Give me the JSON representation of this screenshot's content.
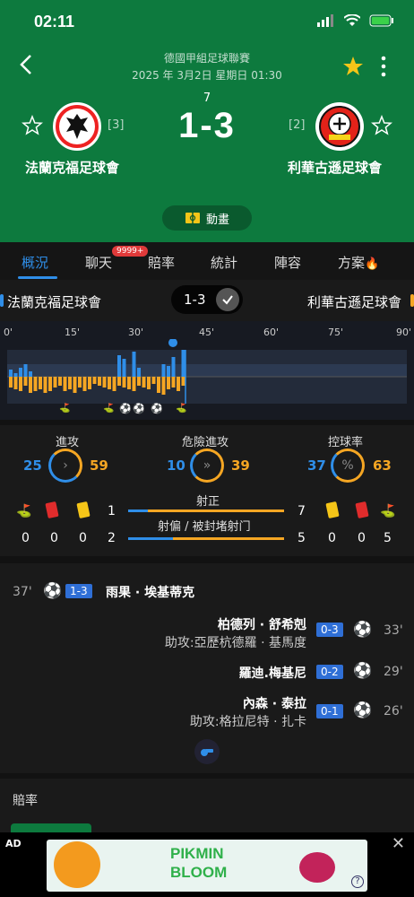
{
  "status_bar": {
    "time": "02:11"
  },
  "match": {
    "league": "德國甲組足球聯賽",
    "datetime": "2025 年 3月2日 星期日 01:30",
    "round": "7",
    "score": "1-3",
    "home": {
      "name": "法蘭克福足球會",
      "rank": "[3]"
    },
    "away": {
      "name": "利華古遜足球會",
      "rank": "[2]"
    },
    "animation_label": "動畫"
  },
  "tabs": [
    {
      "label": "概況"
    },
    {
      "label": "聊天"
    },
    {
      "label": "賠率"
    },
    {
      "label": "統計"
    },
    {
      "label": "陣容"
    },
    {
      "label": "方案"
    }
  ],
  "chat_badge": "9999+",
  "team_bar": {
    "home": "法蘭克福足球會",
    "score": "1-3",
    "away": "利華古遜足球會"
  },
  "timeline": {
    "minute_labels": [
      "0'",
      "15'",
      "30'",
      "45'",
      "60'",
      "75'",
      "90'"
    ],
    "current_minute": 45
  },
  "stats": {
    "attack": {
      "label": "進攻",
      "home": "25",
      "away": "59"
    },
    "dangerous_attack": {
      "label": "危險進攻",
      "home": "10",
      "away": "39"
    },
    "possession": {
      "label": "控球率",
      "home": "37",
      "away": "63"
    },
    "shots_on_target": {
      "label": "射正",
      "home": "1",
      "away": "7"
    },
    "shots_off": {
      "label": "射偏 / 被封堵射门",
      "home": "2",
      "away": "5"
    },
    "home_cards": {
      "corners": "0",
      "red": "0",
      "yellow": "0"
    },
    "away_cards": {
      "yellow": "0",
      "red": "0",
      "corners": "5"
    }
  },
  "events": [
    {
      "minute": "37'",
      "score": "1-3",
      "player": "雨果 · 埃基蒂克",
      "assist": ""
    },
    {
      "minute": "33'",
      "score": "0-3",
      "player": "柏德列 · 舒希剋",
      "assist": "助攻:亞歷杭德羅 · 基馬度"
    },
    {
      "minute": "29'",
      "score": "0-2",
      "player": "羅迪.梅基尼",
      "assist": ""
    },
    {
      "minute": "26'",
      "score": "0-1",
      "player": "內森 · 泰拉",
      "assist": "助攻:格拉尼特 · 扎卡"
    }
  ],
  "odds": {
    "title": "賠率"
  },
  "ad": {
    "label": "AD",
    "brand_top": "PIKMIN",
    "brand_bottom": "BLOOM"
  },
  "colors": {
    "header_green": "#0d7a3e",
    "home_blue": "#2f8ee8",
    "away_orange": "#f5a623"
  }
}
